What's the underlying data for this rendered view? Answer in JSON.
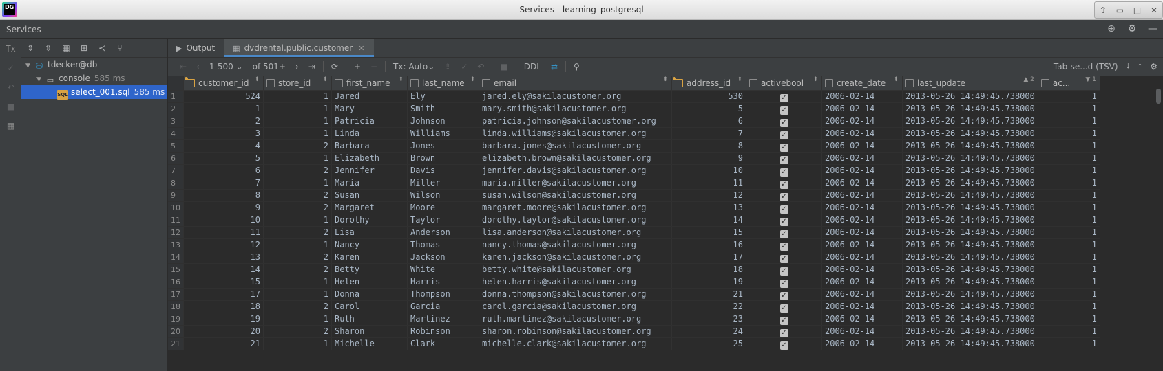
{
  "window": {
    "title": "Services - learning_postgresql",
    "logo": "DG",
    "controls": [
      "⇧",
      "▭",
      "□",
      "✕"
    ]
  },
  "services": {
    "title": "Services",
    "header_icons": [
      "target-icon",
      "gear-icon",
      "minimize-icon"
    ]
  },
  "left_strip": {
    "tx_label": "Tx"
  },
  "tree": {
    "items": [
      {
        "label": "tdecker@db",
        "extra": "",
        "level": 0
      },
      {
        "label": "console",
        "extra": "585 ms",
        "level": 1
      },
      {
        "label": "select_001.sql",
        "extra": "585 ms",
        "level": 2
      }
    ]
  },
  "tabs": [
    {
      "label": "Output",
      "active": false
    },
    {
      "label": "dvdrental.public.customer",
      "active": true
    }
  ],
  "grid_toolbar": {
    "range": "1-500",
    "of": "of 501+",
    "tx": "Tx: Auto",
    "ddl": "DDL",
    "export_format": "Tab-se...d (TSV)"
  },
  "columns": [
    {
      "name": "customer_id",
      "sort": "⬍",
      "key": true
    },
    {
      "name": "store_id",
      "sort": "⬍",
      "key": false
    },
    {
      "name": "first_name",
      "sort": "⬍",
      "key": false
    },
    {
      "name": "last_name",
      "sort": "⬍",
      "key": false
    },
    {
      "name": "email",
      "sort": "⬍",
      "key": false
    },
    {
      "name": "address_id",
      "sort": "⬍",
      "key": true
    },
    {
      "name": "activebool",
      "sort": "⬍",
      "key": false
    },
    {
      "name": "create_date",
      "sort": "⬍",
      "key": false
    },
    {
      "name": "last_update",
      "sort": "▲ 2",
      "key": false
    },
    {
      "name": "ac...",
      "sort": "▼ 1",
      "key": false
    }
  ],
  "rows": [
    [
      "524",
      "1",
      "Jared",
      "Ely",
      "jared.ely@sakilacustomer.org",
      "530",
      "2006-02-14",
      "2013-05-26 14:49:45.738000",
      "1"
    ],
    [
      "1",
      "1",
      "Mary",
      "Smith",
      "mary.smith@sakilacustomer.org",
      "5",
      "2006-02-14",
      "2013-05-26 14:49:45.738000",
      "1"
    ],
    [
      "2",
      "1",
      "Patricia",
      "Johnson",
      "patricia.johnson@sakilacustomer.org",
      "6",
      "2006-02-14",
      "2013-05-26 14:49:45.738000",
      "1"
    ],
    [
      "3",
      "1",
      "Linda",
      "Williams",
      "linda.williams@sakilacustomer.org",
      "7",
      "2006-02-14",
      "2013-05-26 14:49:45.738000",
      "1"
    ],
    [
      "4",
      "2",
      "Barbara",
      "Jones",
      "barbara.jones@sakilacustomer.org",
      "8",
      "2006-02-14",
      "2013-05-26 14:49:45.738000",
      "1"
    ],
    [
      "5",
      "1",
      "Elizabeth",
      "Brown",
      "elizabeth.brown@sakilacustomer.org",
      "9",
      "2006-02-14",
      "2013-05-26 14:49:45.738000",
      "1"
    ],
    [
      "6",
      "2",
      "Jennifer",
      "Davis",
      "jennifer.davis@sakilacustomer.org",
      "10",
      "2006-02-14",
      "2013-05-26 14:49:45.738000",
      "1"
    ],
    [
      "7",
      "1",
      "Maria",
      "Miller",
      "maria.miller@sakilacustomer.org",
      "11",
      "2006-02-14",
      "2013-05-26 14:49:45.738000",
      "1"
    ],
    [
      "8",
      "2",
      "Susan",
      "Wilson",
      "susan.wilson@sakilacustomer.org",
      "12",
      "2006-02-14",
      "2013-05-26 14:49:45.738000",
      "1"
    ],
    [
      "9",
      "2",
      "Margaret",
      "Moore",
      "margaret.moore@sakilacustomer.org",
      "13",
      "2006-02-14",
      "2013-05-26 14:49:45.738000",
      "1"
    ],
    [
      "10",
      "1",
      "Dorothy",
      "Taylor",
      "dorothy.taylor@sakilacustomer.org",
      "14",
      "2006-02-14",
      "2013-05-26 14:49:45.738000",
      "1"
    ],
    [
      "11",
      "2",
      "Lisa",
      "Anderson",
      "lisa.anderson@sakilacustomer.org",
      "15",
      "2006-02-14",
      "2013-05-26 14:49:45.738000",
      "1"
    ],
    [
      "12",
      "1",
      "Nancy",
      "Thomas",
      "nancy.thomas@sakilacustomer.org",
      "16",
      "2006-02-14",
      "2013-05-26 14:49:45.738000",
      "1"
    ],
    [
      "13",
      "2",
      "Karen",
      "Jackson",
      "karen.jackson@sakilacustomer.org",
      "17",
      "2006-02-14",
      "2013-05-26 14:49:45.738000",
      "1"
    ],
    [
      "14",
      "2",
      "Betty",
      "White",
      "betty.white@sakilacustomer.org",
      "18",
      "2006-02-14",
      "2013-05-26 14:49:45.738000",
      "1"
    ],
    [
      "15",
      "1",
      "Helen",
      "Harris",
      "helen.harris@sakilacustomer.org",
      "19",
      "2006-02-14",
      "2013-05-26 14:49:45.738000",
      "1"
    ],
    [
      "17",
      "1",
      "Donna",
      "Thompson",
      "donna.thompson@sakilacustomer.org",
      "21",
      "2006-02-14",
      "2013-05-26 14:49:45.738000",
      "1"
    ],
    [
      "18",
      "2",
      "Carol",
      "Garcia",
      "carol.garcia@sakilacustomer.org",
      "22",
      "2006-02-14",
      "2013-05-26 14:49:45.738000",
      "1"
    ],
    [
      "19",
      "1",
      "Ruth",
      "Martinez",
      "ruth.martinez@sakilacustomer.org",
      "23",
      "2006-02-14",
      "2013-05-26 14:49:45.738000",
      "1"
    ],
    [
      "20",
      "2",
      "Sharon",
      "Robinson",
      "sharon.robinson@sakilacustomer.org",
      "24",
      "2006-02-14",
      "2013-05-26 14:49:45.738000",
      "1"
    ],
    [
      "21",
      "1",
      "Michelle",
      "Clark",
      "michelle.clark@sakilacustomer.org",
      "25",
      "2006-02-14",
      "2013-05-26 14:49:45.738000",
      "1"
    ]
  ]
}
